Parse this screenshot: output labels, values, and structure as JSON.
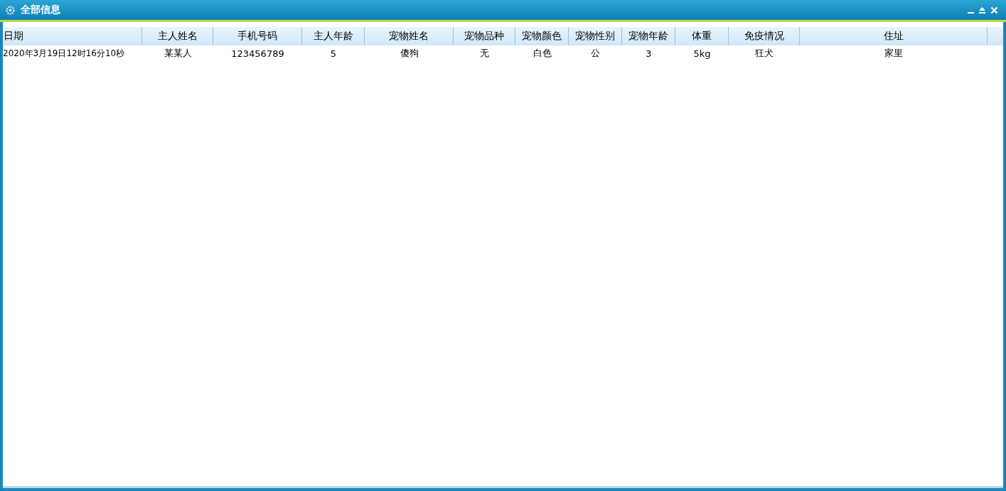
{
  "window": {
    "title": "全部信息"
  },
  "table": {
    "columns": [
      "日期",
      "主人姓名",
      "手机号码",
      "主人年龄",
      "宠物姓名",
      "宠物品种",
      "宠物颜色",
      "宠物性别",
      "宠物年龄",
      "体重",
      "免疫情况",
      "住址"
    ],
    "rows": [
      [
        "2020年3月19日12时16分10秒",
        "某某人",
        "123456789",
        "5",
        "傻狗",
        "无",
        "白色",
        "公",
        "3",
        "5kg",
        "狂犬",
        "家里"
      ]
    ]
  }
}
